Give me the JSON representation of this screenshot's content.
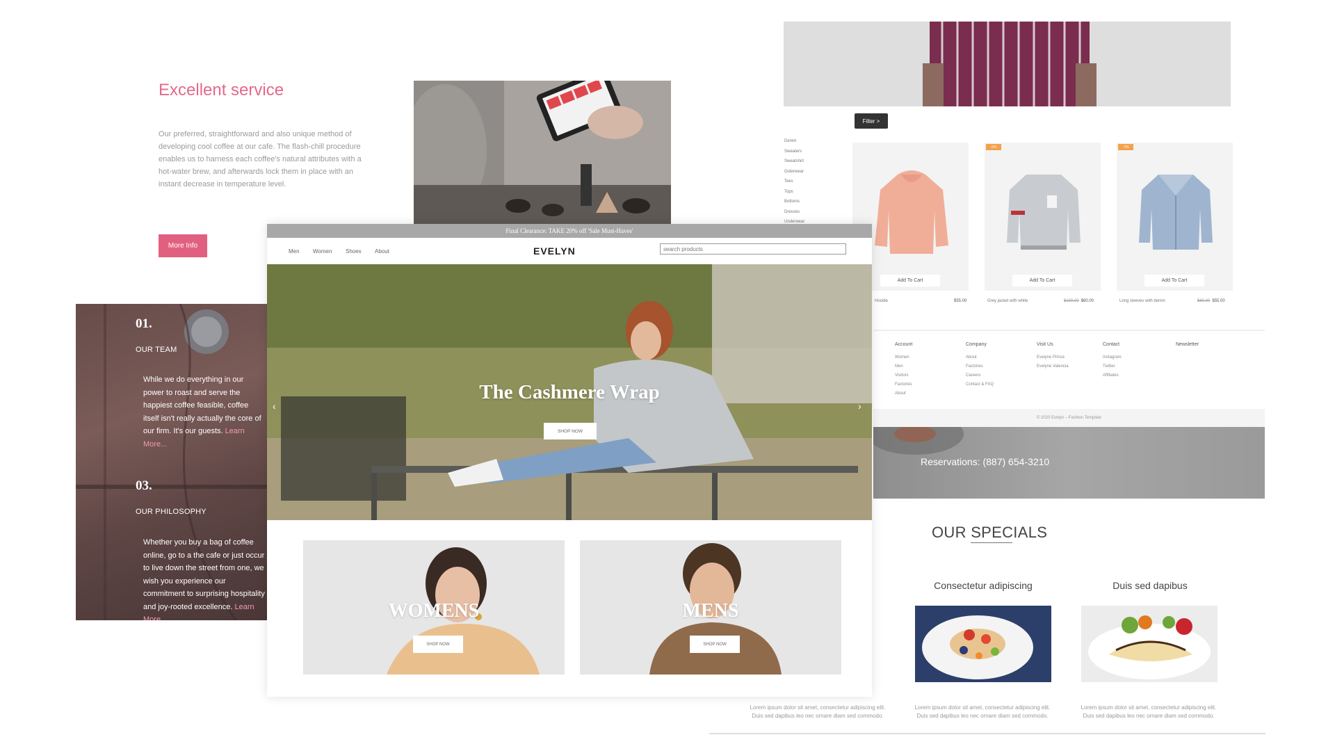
{
  "service": {
    "title": "Excellent service",
    "text": "Our preferred, straightforward and also unique method of developing cool coffee at our cafe. The flash-chill procedure enables us to harness each coffee's natural attributes with a hot-water brew, and afterwards lock them in place with an instant decrease in temperature level.",
    "button": "More Info"
  },
  "coffee": {
    "items": [
      {
        "num": "01.",
        "heading": "OUR TEAM",
        "text": "While we do everything in our power to roast and serve the happiest coffee feasible, coffee itself isn't really actually the core of our firm. It's our guests.",
        "link": "Learn More..."
      },
      {
        "num": "03.",
        "heading": "OUR PHILOSOPHY",
        "text": "Whether you buy a bag of coffee online, go to a the cafe or just occur to live down the street from one, we wish you experience our commitment to surprising hospitality and joy-rooted excellence.",
        "link": "Learn More..."
      }
    ]
  },
  "shop": {
    "filter": "Filter >",
    "categories": [
      "Denim",
      "Sweaters",
      "Sweatshirt",
      "Outerwear",
      "Tees",
      "Tops",
      "Bottoms",
      "Dresses",
      "Underwear"
    ],
    "products": [
      {
        "name": "Hoodie",
        "price": "$55.00",
        "old_price": "",
        "badge": "",
        "cart": "Add To Cart"
      },
      {
        "name": "Grey jacket with white",
        "price": "$60.00",
        "old_price": "$100.00",
        "badge": "-5%",
        "cart": "Add To Cart"
      },
      {
        "name": "Long sleeves with denim",
        "price": "$55.00",
        "old_price": "$60.00",
        "badge": "-7%",
        "cart": "Add To Cart"
      }
    ],
    "footer": {
      "columns": [
        {
          "title": "Account",
          "items": [
            "Women",
            "Men",
            "Visitors",
            "Factories",
            "About"
          ]
        },
        {
          "title": "Company",
          "items": [
            "About",
            "Factories",
            "Careers",
            "Contact & FAQ"
          ]
        },
        {
          "title": "Visit Us",
          "items": [
            "Evelyne Prince",
            "Evelyne Valencia"
          ]
        },
        {
          "title": "Contact",
          "items": [
            "Instagram",
            "Twitter",
            "Affiliates"
          ]
        },
        {
          "title": "Newsletter",
          "items": []
        }
      ],
      "copyright": "© 2020 Evelyn – Fashion Template"
    }
  },
  "restaurant": {
    "reservation": "Reservations: (887) 654-3210",
    "specials_title": "OUR SPECIALS",
    "dishes": [
      {
        "name": "Consectetur adipiscing",
        "text": "Lorem ipsum dolor sit amet, consectetur adipiscing elit. Duis sed dapibus leo nec ornare diam sed commodo."
      },
      {
        "name": "Duis sed dapibus",
        "text": "Lorem ipsum dolor sit amet, consectetur adipiscing elit. Duis sed dapibus leo nec ornare diam sed commodo."
      }
    ],
    "left_text": "Lorem ipsum dolor sit amet, consectetur adipiscing elit. Duis sed dapibus leo nec ornare diam sed commodo."
  },
  "evelyn": {
    "promo": "Final Clearance: TAKE 20% off 'Sale Must-Haves'",
    "nav": [
      "Men",
      "Women",
      "Shoes",
      "About"
    ],
    "logo": "EVELYN",
    "search_placeholder": "search products",
    "hero_title": "The Cashmere Wrap",
    "hero_button": "SHOP NOW",
    "cards": [
      {
        "title": "WOMENS",
        "button": "SHOP NOW"
      },
      {
        "title": "MENS",
        "button": "SHOP NOW"
      }
    ]
  }
}
